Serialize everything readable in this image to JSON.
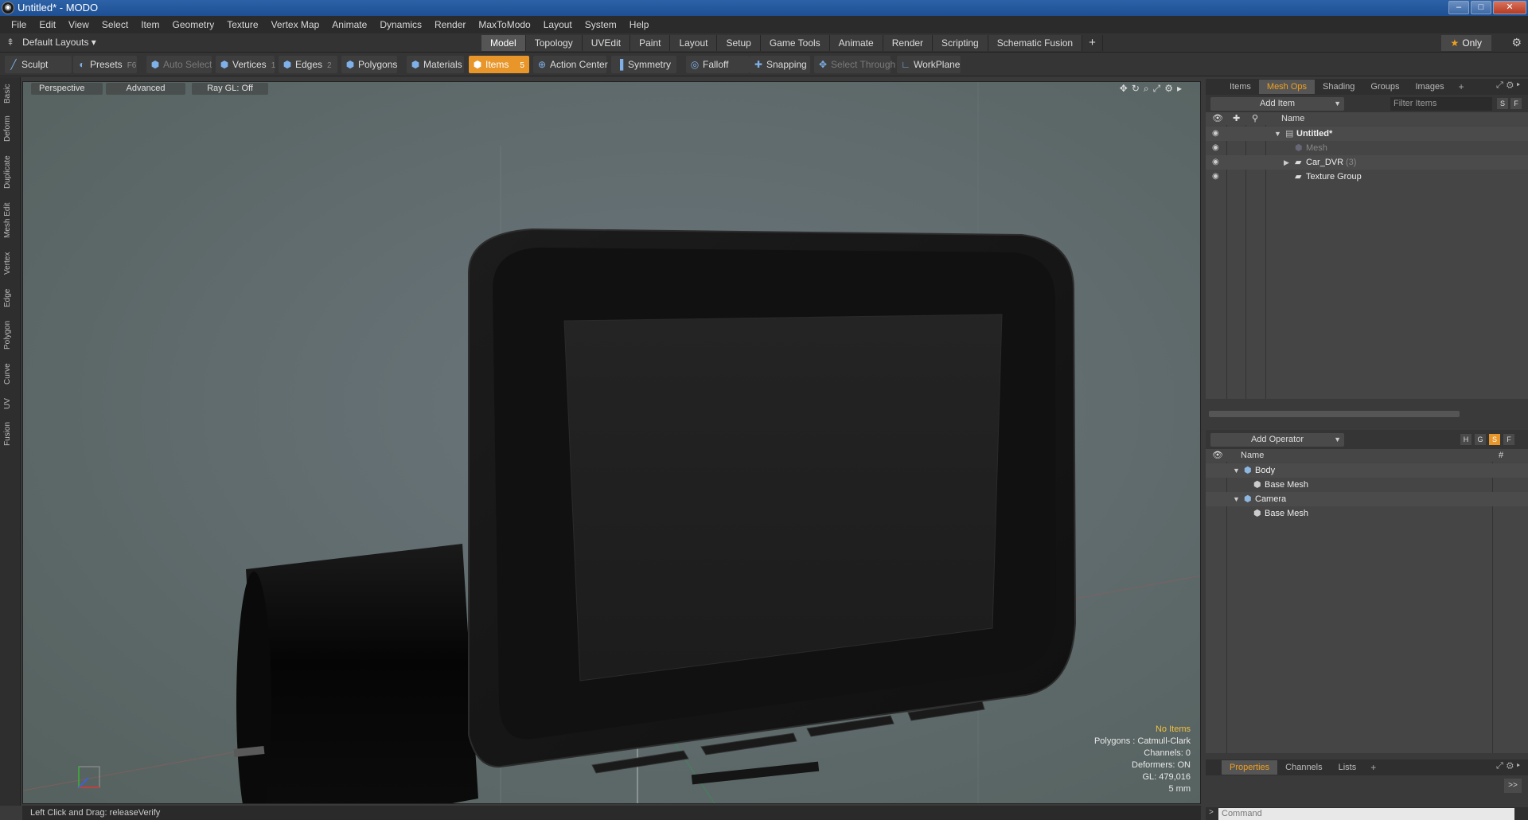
{
  "window": {
    "title": "Untitled* - MODO",
    "buttons": [
      "–",
      "□",
      "✕"
    ]
  },
  "menu": [
    "File",
    "Edit",
    "View",
    "Select",
    "Item",
    "Geometry",
    "Texture",
    "Vertex Map",
    "Animate",
    "Dynamics",
    "Render",
    "MaxToModo",
    "Layout",
    "System",
    "Help"
  ],
  "layouts": {
    "dropdown": "Default Layouts ▾",
    "tabs": [
      "Model",
      "Topology",
      "UVEdit",
      "Paint",
      "Layout",
      "Setup",
      "Game Tools",
      "Animate",
      "Render",
      "Scripting",
      "Schematic Fusion"
    ],
    "active_tab": "Model",
    "only": "Only"
  },
  "toolbar": {
    "sculpt": "Sculpt",
    "presets": "Presets",
    "presets_key": "F6",
    "auto_select": "Auto Select",
    "vertices": "Vertices",
    "vertices_key": "1",
    "edges": "Edges",
    "edges_key": "2",
    "polygons": "Polygons",
    "materials": "Materials",
    "items": "Items",
    "items_key": "5",
    "action_center": "Action Center",
    "symmetry": "Symmetry",
    "falloff": "Falloff",
    "snapping": "Snapping",
    "select_through": "Select Through",
    "workplane": "WorkPlane"
  },
  "left_tabs": [
    "Basic",
    "Deform",
    "Duplicate",
    "Mesh Edit",
    "Vertex",
    "Edge",
    "Polygon",
    "Curve",
    "UV",
    "Fusion"
  ],
  "viewport": {
    "view": "Perspective",
    "mode": "Advanced",
    "raygl": "Ray GL: Off",
    "info": {
      "selection": "No Items",
      "polygons": "Polygons : Catmull-Clark",
      "channels": "Channels: 0",
      "deformers": "Deformers: ON",
      "gl": "GL: 479,016",
      "unit": "5 mm"
    },
    "background_color": "#5e6a70"
  },
  "status": {
    "text": "Left Click and Drag:   releaseVerify"
  },
  "items_panel": {
    "tabs": [
      "Items",
      "Mesh Ops",
      "Shading",
      "Groups",
      "Images"
    ],
    "active_tab": "Mesh Ops",
    "add_item": "Add Item",
    "filter_placeholder": "Filter Items",
    "s_btn": "S",
    "f_btn": "F",
    "name_col": "Name",
    "rows": [
      {
        "label": "Untitled*",
        "count": ""
      },
      {
        "label": "Mesh",
        "count": ""
      },
      {
        "label": "Car_DVR",
        "count": "(3)"
      },
      {
        "label": "Texture Group",
        "count": ""
      }
    ]
  },
  "operator_panel": {
    "add_operator": "Add Operator",
    "btns": [
      "H",
      "G",
      "S",
      "F"
    ],
    "name_col": "Name",
    "hash_col": "#",
    "rows": [
      {
        "label": "Body"
      },
      {
        "label": "Base Mesh"
      },
      {
        "label": "Camera"
      },
      {
        "label": "Base Mesh"
      }
    ]
  },
  "properties_panel": {
    "tabs": [
      "Properties",
      "Channels",
      "Lists"
    ],
    "active_tab": "Properties",
    "expand": ">>"
  },
  "command": {
    "placeholder": "Command"
  },
  "colors": {
    "accent": "#e8962a",
    "titlebar": "#1e4f93"
  }
}
